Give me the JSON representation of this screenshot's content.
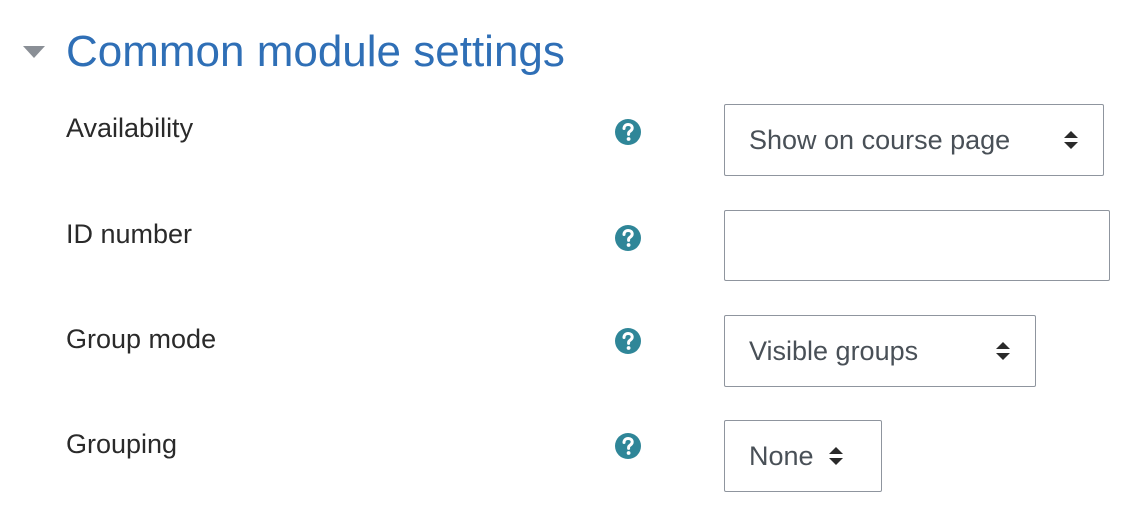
{
  "section": {
    "title": "Common module settings",
    "toggle_icon": "caret-down-icon",
    "title_color": "#2f6fb6"
  },
  "fields": {
    "availability": {
      "label": "Availability",
      "help_icon": "question-circle-icon",
      "selected": "Show on course page"
    },
    "id_number": {
      "label": "ID number",
      "help_icon": "question-circle-icon",
      "value": "",
      "placeholder": ""
    },
    "group_mode": {
      "label": "Group mode",
      "help_icon": "question-circle-icon",
      "selected": "Visible groups"
    },
    "grouping": {
      "label": "Grouping",
      "help_icon": "question-circle-icon",
      "selected": "None"
    }
  },
  "colors": {
    "help_icon": "#2f8698",
    "label_text": "#2a2a2a",
    "select_text": "#495057",
    "border": "#8f959e"
  }
}
